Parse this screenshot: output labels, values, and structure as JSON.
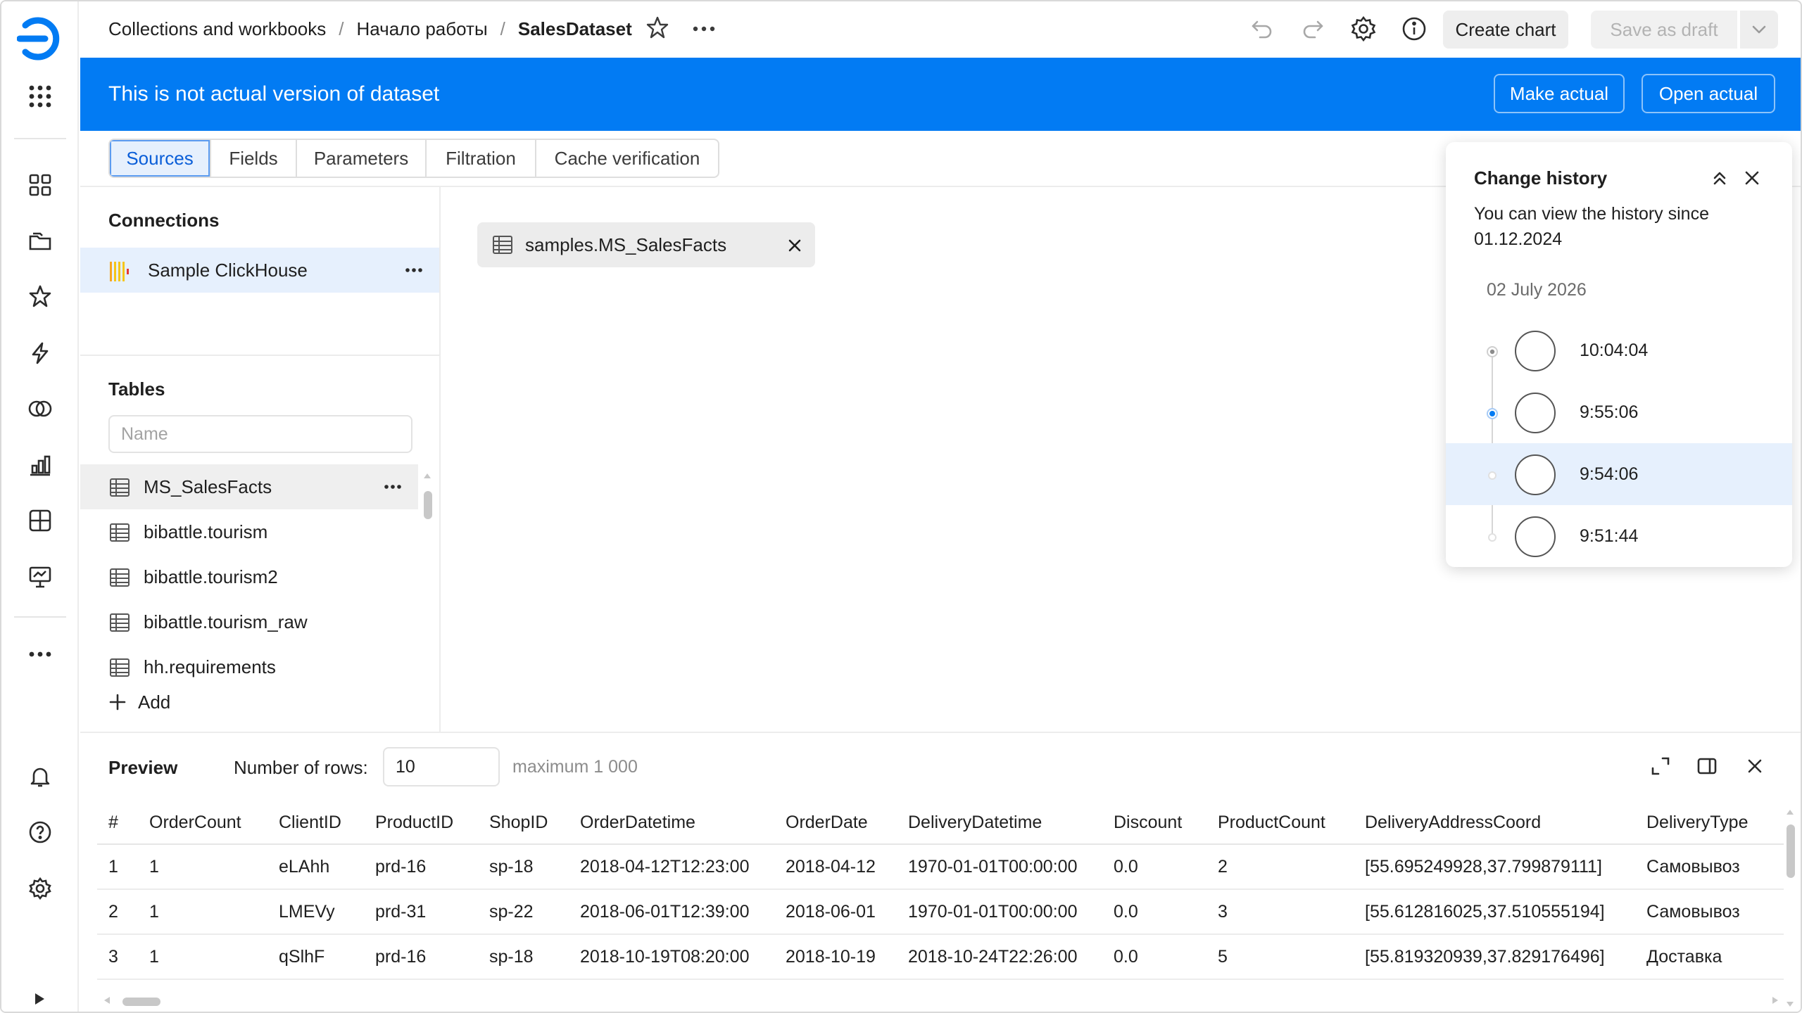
{
  "breadcrumbs": [
    "Collections and workbooks",
    "Начало работы",
    "SalesDataset"
  ],
  "toolbar": {
    "create_chart": "Create chart",
    "save_as_draft": "Save as draft"
  },
  "banner": {
    "text": "This is not actual version of dataset",
    "make_actual": "Make actual",
    "open_actual": "Open actual"
  },
  "tabs": [
    "Sources",
    "Fields",
    "Parameters",
    "Filtration",
    "Cache verification"
  ],
  "active_tab": "Sources",
  "connections": {
    "title": "Connections",
    "items": [
      "Sample ClickHouse"
    ]
  },
  "tables": {
    "title": "Tables",
    "search_placeholder": "Name",
    "items": [
      "MS_SalesFacts",
      "bibattle.tourism",
      "bibattle.tourism2",
      "bibattle.tourism_raw",
      "hh.requirements"
    ],
    "add_label": "Add"
  },
  "canvas": {
    "source": "samples.MS_SalesFacts"
  },
  "history": {
    "title": "Change history",
    "note": "You can view the history since 01.12.2024",
    "date": "02 July 2026",
    "entries": [
      {
        "time": "10:04:04",
        "state": "current"
      },
      {
        "time": "9:55:06",
        "state": "selected"
      },
      {
        "time": "9:54:06",
        "state": "hover"
      },
      {
        "time": "9:51:44",
        "state": "normal"
      }
    ]
  },
  "preview": {
    "title": "Preview",
    "rows_label": "Number of rows:",
    "rows_value": "10",
    "maximum": "maximum 1 000",
    "columns": [
      "#",
      "OrderCount",
      "ClientID",
      "ProductID",
      "ShopID",
      "OrderDatetime",
      "OrderDate",
      "DeliveryDatetime",
      "Discount",
      "ProductCount",
      "DeliveryAddressCoord",
      "DeliveryType"
    ],
    "rows": [
      [
        "1",
        "1",
        "eLAhh",
        "prd-16",
        "sp-18",
        "2018-04-12T12:23:00",
        "2018-04-12",
        "1970-01-01T00:00:00",
        "0.0",
        "2",
        "[55.695249928,37.799879111]",
        "Самовывоз"
      ],
      [
        "2",
        "1",
        "LMEVy",
        "prd-31",
        "sp-22",
        "2018-06-01T12:39:00",
        "2018-06-01",
        "1970-01-01T00:00:00",
        "0.0",
        "3",
        "[55.612816025,37.510555194]",
        "Самовывоз"
      ],
      [
        "3",
        "1",
        "qSlhF",
        "prd-16",
        "sp-18",
        "2018-10-19T08:20:00",
        "2018-10-19",
        "2018-10-24T22:26:00",
        "0.0",
        "5",
        "[55.819320939,37.829176496]",
        "Доставка"
      ]
    ]
  },
  "colors": {
    "accent": "#027bf3",
    "active_tab_bg": "#e6f0fd",
    "selected_row_bg": "#efefef"
  }
}
